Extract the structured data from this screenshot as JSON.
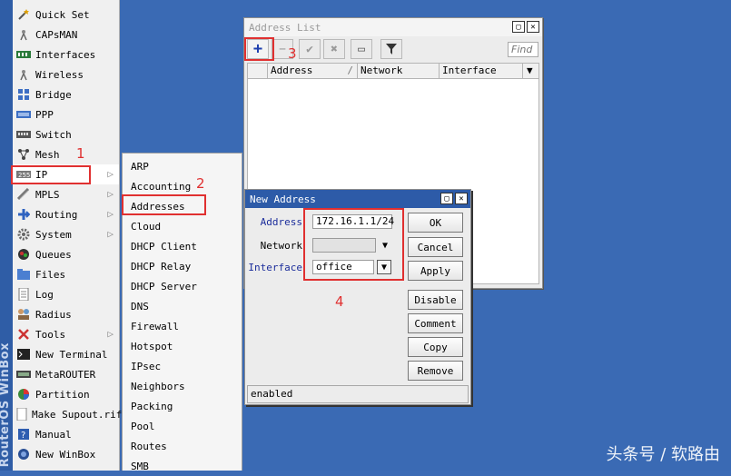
{
  "brand": {
    "text": "RouterOS WinBox"
  },
  "menu": {
    "items": [
      {
        "label": "Quick Set",
        "icon": "wand-icon"
      },
      {
        "label": "CAPsMAN",
        "icon": "antenna-icon"
      },
      {
        "label": "Interfaces",
        "icon": "interfaces-icon"
      },
      {
        "label": "Wireless",
        "icon": "antenna-icon"
      },
      {
        "label": "Bridge",
        "icon": "bridge-icon"
      },
      {
        "label": "PPP",
        "icon": "ppp-icon"
      },
      {
        "label": "Switch",
        "icon": "switch-icon"
      },
      {
        "label": "Mesh",
        "icon": "mesh-icon"
      },
      {
        "label": "IP",
        "icon": "ip-icon",
        "has_submenu": true
      },
      {
        "label": "MPLS",
        "icon": "mpls-icon",
        "has_submenu": true
      },
      {
        "label": "Routing",
        "icon": "routing-icon",
        "has_submenu": true
      },
      {
        "label": "System",
        "icon": "gear-icon",
        "has_submenu": true
      },
      {
        "label": "Queues",
        "icon": "queues-icon"
      },
      {
        "label": "Files",
        "icon": "folder-icon"
      },
      {
        "label": "Log",
        "icon": "log-icon"
      },
      {
        "label": "Radius",
        "icon": "radius-icon"
      },
      {
        "label": "Tools",
        "icon": "tools-icon",
        "has_submenu": true
      },
      {
        "label": "New Terminal",
        "icon": "terminal-icon"
      },
      {
        "label": "MetaROUTER",
        "icon": "metarouter-icon"
      },
      {
        "label": "Partition",
        "icon": "partition-icon"
      },
      {
        "label": "Make Supout.rif",
        "icon": "supout-icon"
      },
      {
        "label": "Manual",
        "icon": "help-icon"
      },
      {
        "label": "New WinBox",
        "icon": "winbox-icon"
      }
    ],
    "arrow": "▷"
  },
  "submenu": {
    "items": [
      "ARP",
      "Accounting",
      "Addresses",
      "Cloud",
      "DHCP Client",
      "DHCP Relay",
      "DHCP Server",
      "DNS",
      "Firewall",
      "Hotspot",
      "IPsec",
      "Neighbors",
      "Packing",
      "Pool",
      "Routes",
      "SMB"
    ]
  },
  "address_list": {
    "title": "Address List",
    "find_placeholder": "Find",
    "columns": [
      "Address",
      "Network",
      "Interface"
    ],
    "sort_marker": "/",
    "toolbar": {
      "add": "+",
      "remove": "−",
      "enable": "✔",
      "disable": "✖",
      "comment": "▭",
      "filter": "filter"
    }
  },
  "new_address": {
    "title": "New Address",
    "labels": {
      "address": "Address",
      "network": "Network",
      "interface": "Interface"
    },
    "values": {
      "address": "172.16.1.1/24",
      "network": "",
      "interface": "office"
    },
    "buttons": {
      "ok": "OK",
      "cancel": "Cancel",
      "apply": "Apply",
      "disable": "Disable",
      "comment": "Comment",
      "copy": "Copy",
      "remove": "Remove"
    },
    "status": "enabled"
  },
  "annotations": {
    "step1": "1",
    "step2": "2",
    "step3": "3",
    "step4": "4",
    "color": "#e03030"
  },
  "watermark": "头条号 / 软路由"
}
